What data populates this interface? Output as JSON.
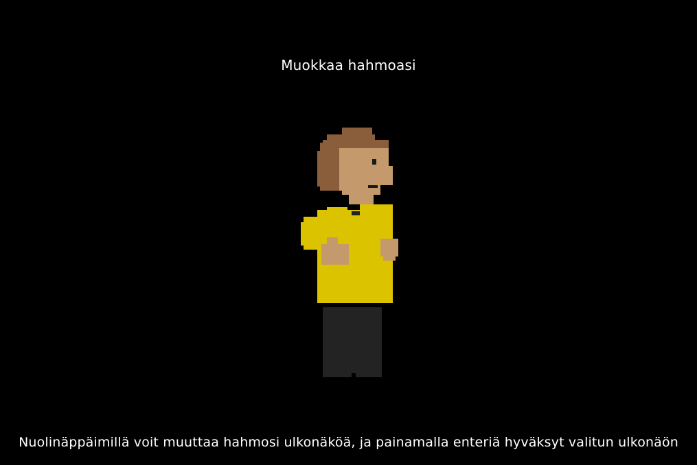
{
  "screen": {
    "title": "Muokkaa hahmoasi",
    "instructions": "Nuolinäppäimillä voit muuttaa hahmosi ulkonäköä, ja painamalla enteriä hyväksyt valitun ulkonäön"
  },
  "character": {
    "colors": {
      "hair": "#8a5e3b",
      "skin": "#c49a6c",
      "shirt": "#dcc300",
      "pants": "#232323",
      "eye": "#1a1a1a",
      "background": "#000000"
    }
  }
}
